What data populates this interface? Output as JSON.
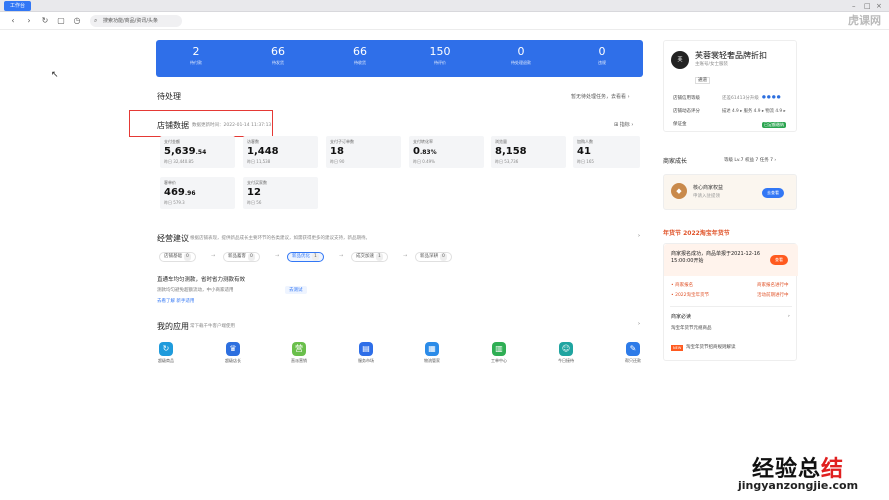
{
  "window": {
    "tab": "工作台"
  },
  "address": {
    "text": "搜索功能/商品/资讯/头条"
  },
  "watermark": "虎课网",
  "stats": [
    {
      "value": "2",
      "label": "待付款"
    },
    {
      "value": "66",
      "label": "待发货"
    },
    {
      "value": "66",
      "label": "待收货"
    },
    {
      "value": "150",
      "label": "待评价"
    },
    {
      "value": "0",
      "label": "待处理退款"
    },
    {
      "value": "0",
      "label": "违规"
    }
  ],
  "todo": {
    "title": "待处理",
    "link": "暂无待处理任务，去看看 ›"
  },
  "shop": {
    "title": "店铺数据",
    "updated": "数据更新时间：2022-01-14 11:37:13",
    "indicator": "指标"
  },
  "metrics": [
    {
      "label": "支付金额",
      "value": "5,639",
      "decimal": ".54",
      "sub": "昨日 32,440.85"
    },
    {
      "label": "访客数",
      "value": "1,448",
      "decimal": "",
      "sub": "昨日 11,538"
    },
    {
      "label": "支付子订单数",
      "value": "18",
      "decimal": "",
      "sub": "昨日 90"
    },
    {
      "label": "支付转化率",
      "value": "0",
      "decimal": ".83%",
      "sub": "昨日 0.49%"
    },
    {
      "label": "浏览量",
      "value": "8,158",
      "decimal": "",
      "sub": "昨日 53,736"
    },
    {
      "label": "加购人数",
      "value": "41",
      "decimal": "",
      "sub": "昨日 165"
    },
    {
      "label": "客单价",
      "value": "469",
      "decimal": ".96",
      "sub": "昨日 579.3"
    },
    {
      "label": "支付买家数",
      "value": "12",
      "decimal": "",
      "sub": "昨日 56"
    }
  ],
  "advice": {
    "title": "经营建议",
    "desc": "根据店铺表现，提供新品成长主要环节的各类建议，如需获得更多的建议支持，新品期待。",
    "tabs": [
      {
        "label": "店铺基础",
        "count": "0"
      },
      {
        "label": "新品蓄客",
        "count": "0"
      },
      {
        "label": "新品优化",
        "count": "1"
      },
      {
        "label": "成交加速",
        "count": "1"
      },
      {
        "label": "新品深耕",
        "count": "0"
      }
    ],
    "item_title": "直通车均匀测款，省时省力测款有效",
    "item_desc": "测款均匀避免超额流动，中小商家适用",
    "item_links": "去看了解  新手适用",
    "item_btn": "去测试"
  },
  "apps": {
    "title": "我的应用",
    "desc": "常下载千牛客户端使用",
    "items": [
      {
        "name": "超级商品",
        "color": "#1f9bdc",
        "glyph": "↻"
      },
      {
        "name": "超级店长",
        "color": "#2d6fdf",
        "glyph": "♛"
      },
      {
        "name": "直派营销",
        "color": "#6abf4b",
        "glyph": "营"
      },
      {
        "name": "服务市场",
        "color": "#2e6ee8",
        "glyph": "▤"
      },
      {
        "name": "物流管家",
        "color": "#2b8be8",
        "glyph": "▦"
      },
      {
        "name": "工单中心",
        "color": "#2fae54",
        "glyph": "▥"
      },
      {
        "name": "今日接待",
        "color": "#1fa4a0",
        "glyph": "☺"
      },
      {
        "name": "帮只还款",
        "color": "#2e7be8",
        "glyph": "✎"
      }
    ]
  },
  "profile": {
    "name": "芙蓉裳轻奢品牌折扣",
    "sub": "主账号/女士服装",
    "tag": "通道",
    "level_label": "店铺信用等级",
    "level_val": "还差61413分升级",
    "dsr_label": "店铺动态评分",
    "dsr": "描述 4.9 ▸  服务 4.9 ▸  物流 4.9 ▸",
    "deposit_label": "保证金",
    "deposit_status": "已足额缴纳"
  },
  "growth": {
    "title": "商家成长",
    "stats": "等级 Lv.7  权益 7  任务 7 ›",
    "card_title": "核心商家权益",
    "card_sub": "申请入驻提领",
    "card_btn": "去查看"
  },
  "festival": {
    "title": "年货节  2022淘宝年货节",
    "notice": "商家报名成功，商品单报于2021-12-16 15:00:00开始",
    "notice_btn": "查看",
    "rows": [
      {
        "left": "• 商家报名",
        "right": "商家报名进行中"
      },
      {
        "left": "• 2022淘宝年货节",
        "right": "活动前期进行中"
      }
    ],
    "must_read": "商家必读",
    "must_item": "淘宝年货节元规商品",
    "hot": "淘宝年货节招商规则解读"
  },
  "site": {
    "logo": "经验总结",
    "logo_red": "结",
    "url": "jingyanzongjie.com"
  }
}
